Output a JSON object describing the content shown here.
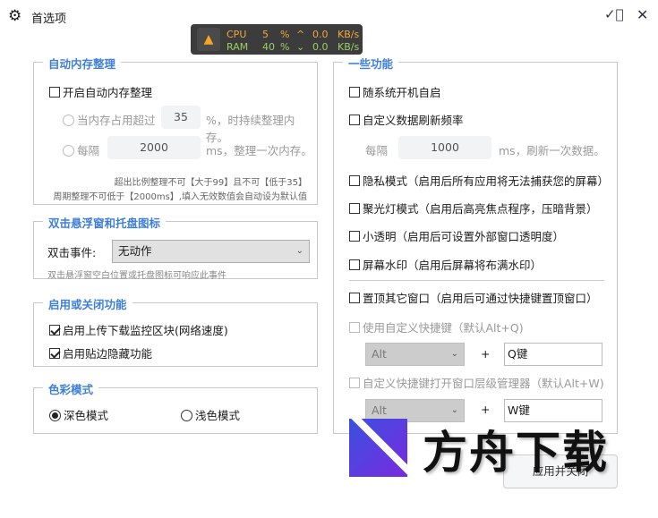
{
  "window": {
    "title": "首选项"
  },
  "monitor": {
    "cpu_label": "CPU",
    "cpu_value": "5",
    "cpu_unit": "%",
    "up_arrow": "^",
    "up_value": "0.0",
    "up_unit": "KB/s",
    "ram_label": "RAM",
    "ram_value": "40",
    "ram_unit": "%",
    "down_arrow": "⌄",
    "down_value": "0.0",
    "down_unit": "KB/s"
  },
  "memory": {
    "title": "自动内存整理",
    "enable": "开启自动内存整理",
    "opt1_label": "当内存占用超过",
    "opt1_value": "35",
    "opt1_suffix": "%，时持续整理内存。",
    "opt2_label": "每隔",
    "opt2_value": "2000",
    "opt2_suffix": "ms，整理一次内存。",
    "hint1": "超出比例整理不可【大于99】且不可【低于35】",
    "hint2": "周期整理不可低于【2000ms】,填入无效数值会自动设为默认值"
  },
  "dblclick": {
    "title": "双击悬浮窗和托盘图标",
    "label": "双击事件:",
    "value": "无动作",
    "hint": "双击悬浮窗空白位置或托盘图标可响应此事件"
  },
  "toggles": {
    "title": "启用或关闭功能",
    "item1": "启用上传下载监控区块(网络速度)",
    "item2": "启用贴边隐藏功能"
  },
  "color": {
    "title": "色彩模式",
    "dark": "深色模式",
    "light": "浅色模式"
  },
  "features": {
    "title": "一些功能",
    "autostart": "随系统开机自启",
    "refresh": "自定义数据刷新频率",
    "refresh_prefix": "每隔",
    "refresh_value": "1000",
    "refresh_suffix": "ms，刷新一次数据。",
    "privacy": "隐私模式（启用后所有应用将无法捕获您的屏幕）",
    "spotlight": "聚光灯模式（启用后高亮焦点程序，压暗背景）",
    "transparent": "小透明（启用后可设置外部窗口透明度）",
    "watermark": "屏幕水印（启用后屏幕将布满水印）",
    "topmost": "置顶其它窗口（启用后可通过快捷键置顶窗口）",
    "hotkey1": "使用自定义快捷键（默认Alt+Q)",
    "hotkey1_mod": "Alt",
    "hotkey1_plus": "+",
    "hotkey1_key": "Q键",
    "hotkey2": "自定义快捷键打开窗口层级管理器（默认Alt+W)",
    "hotkey2_mod": "Alt",
    "hotkey2_plus": "+",
    "hotkey2_key": "W键"
  },
  "footer": {
    "apply": "应用并关闭"
  },
  "watermark_logo": {
    "text": "方舟下载"
  }
}
